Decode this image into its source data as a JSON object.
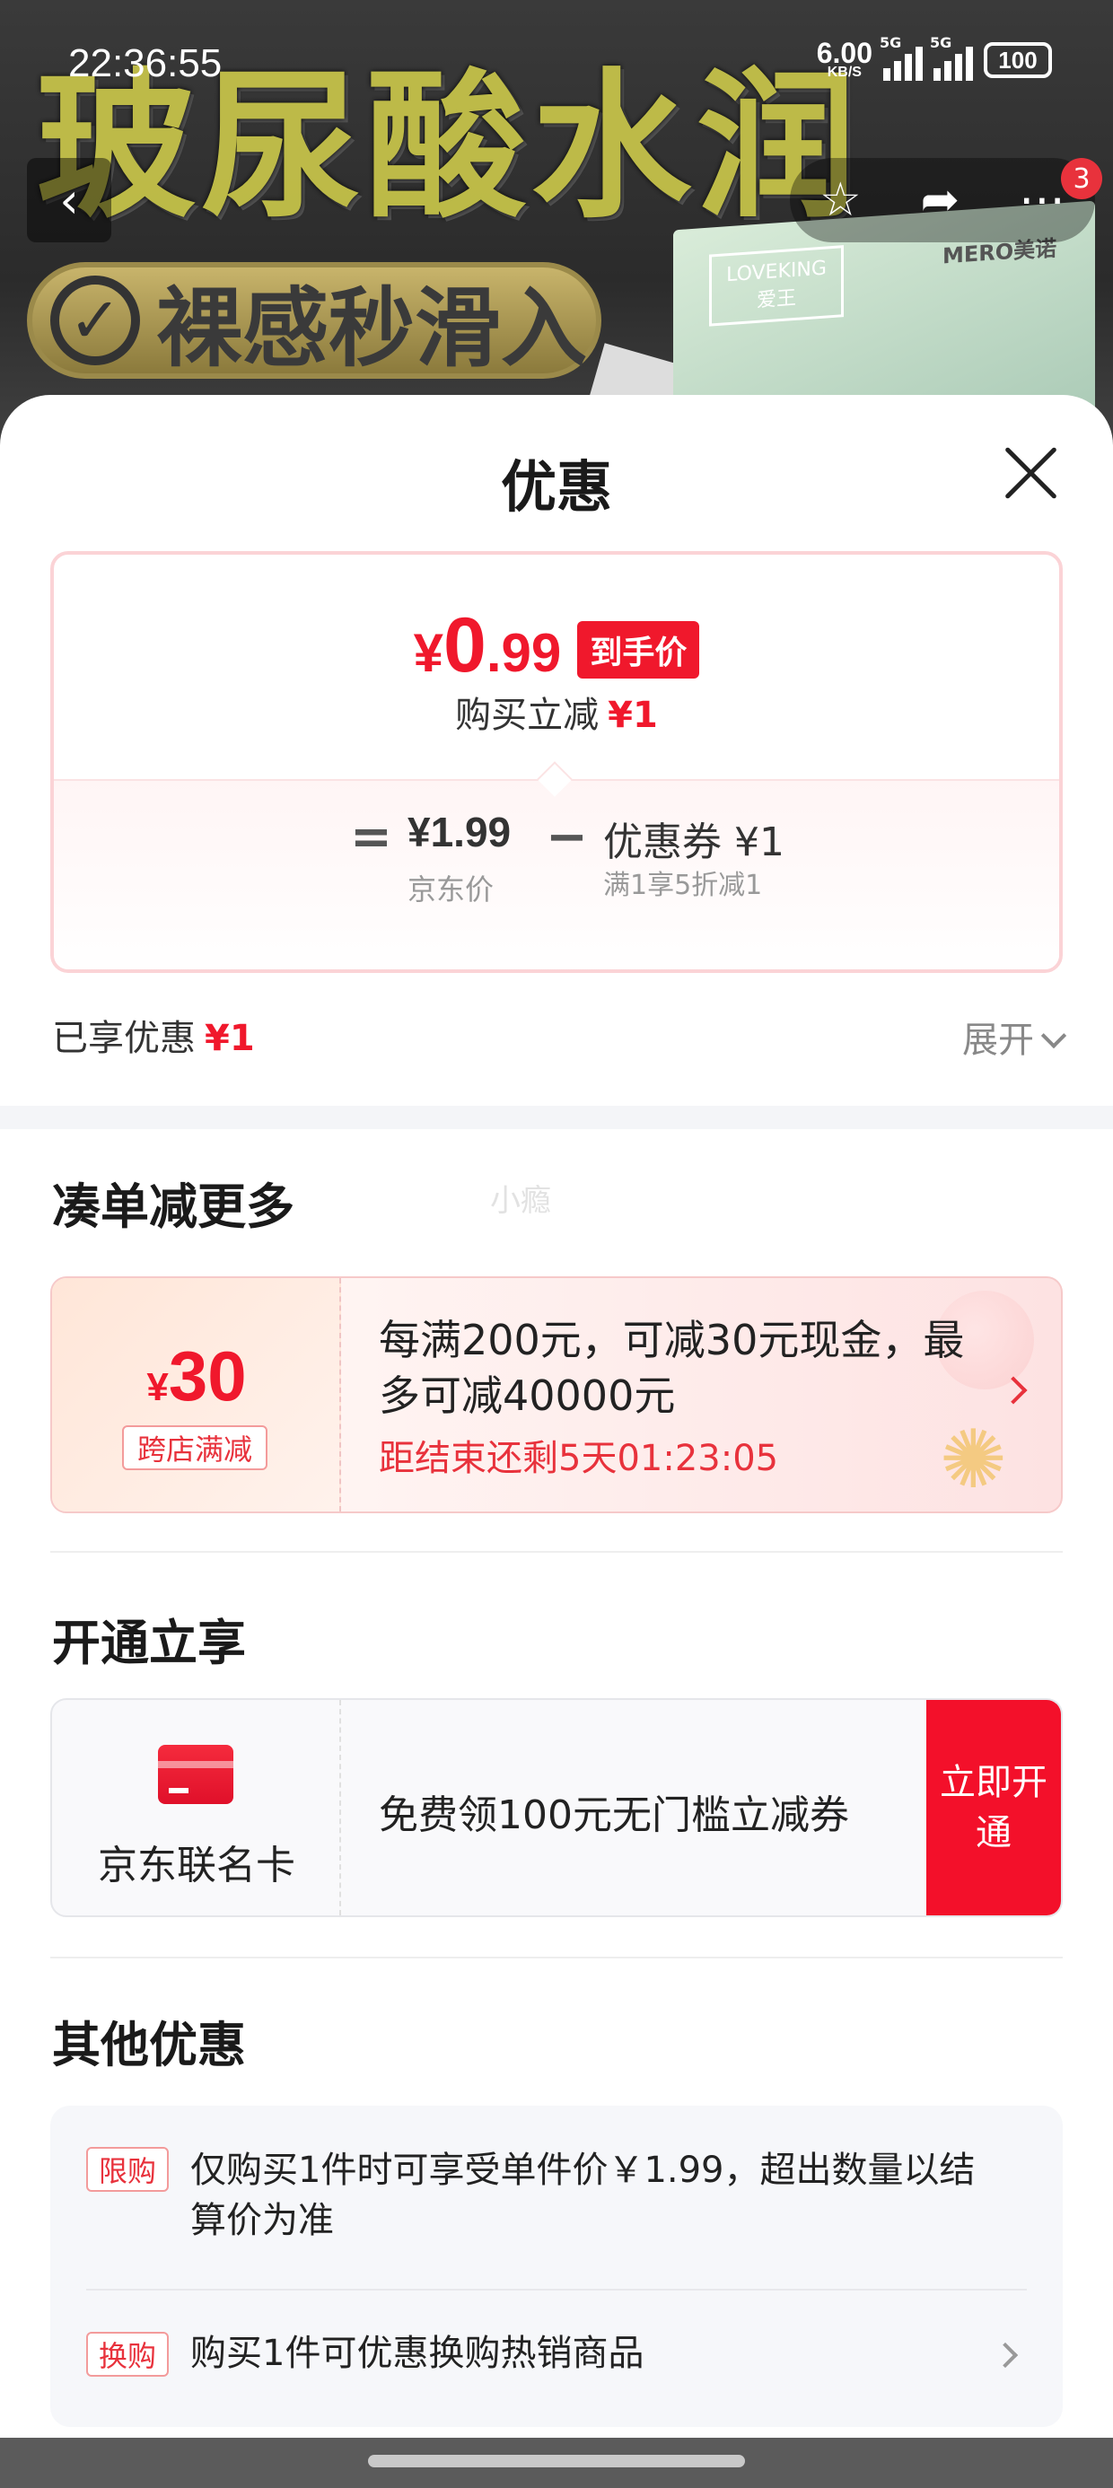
{
  "status_bar": {
    "time": "22:36:55",
    "net_speed": "6.00",
    "net_unit": "KB/S",
    "net_type1": "5G",
    "net_type2": "5G",
    "battery": "100"
  },
  "hero": {
    "title": "玻尿酸水润",
    "badge": "裸感秒滑入",
    "brand1_line1": "LOVEKING",
    "brand1_line2": "爱王",
    "brand2": "MERO美诺",
    "cart_count": "3"
  },
  "sheet": {
    "title": "优惠",
    "price": {
      "yen": "¥",
      "integer": "0",
      "decimal": ".99",
      "tag": "到手价",
      "sub_label": "购买立减",
      "sub_amount": "¥1"
    },
    "calc": {
      "eq": "=",
      "jd_price": "¥1.99",
      "jd_price_label": "京东价",
      "minus": "−",
      "coupon_title": "优惠券 ¥1",
      "coupon_desc": "满1享5折减1"
    },
    "enjoyed_label": "已享优惠",
    "enjoyed_amount": "¥1",
    "expand_label": "展开"
  },
  "more_section": {
    "title": "凑单减更多",
    "watermark": "小瘾",
    "promo": {
      "yen": "¥",
      "amount": "30",
      "tag": "跨店满减",
      "text": "每满200元，可减30元现金，最多可减40000元",
      "countdown": "距结束还剩5天01:23:05"
    }
  },
  "open_section": {
    "title": "开通立享",
    "card_name": "京东联名卡",
    "text": "免费领100元无门槛立减券",
    "button": "立即开通"
  },
  "other_section": {
    "title": "其他优惠",
    "items": [
      {
        "tag": "限购",
        "text": "仅购买1件时可享受单件价￥1.99，超出数量以结算价为准"
      },
      {
        "tag": "换购",
        "text": "购买1件可优惠换购热销商品"
      }
    ]
  },
  "colors": {
    "accent_red": "#f0182c",
    "open_button": "#f3102a",
    "card_border": "#fbd3d6"
  }
}
